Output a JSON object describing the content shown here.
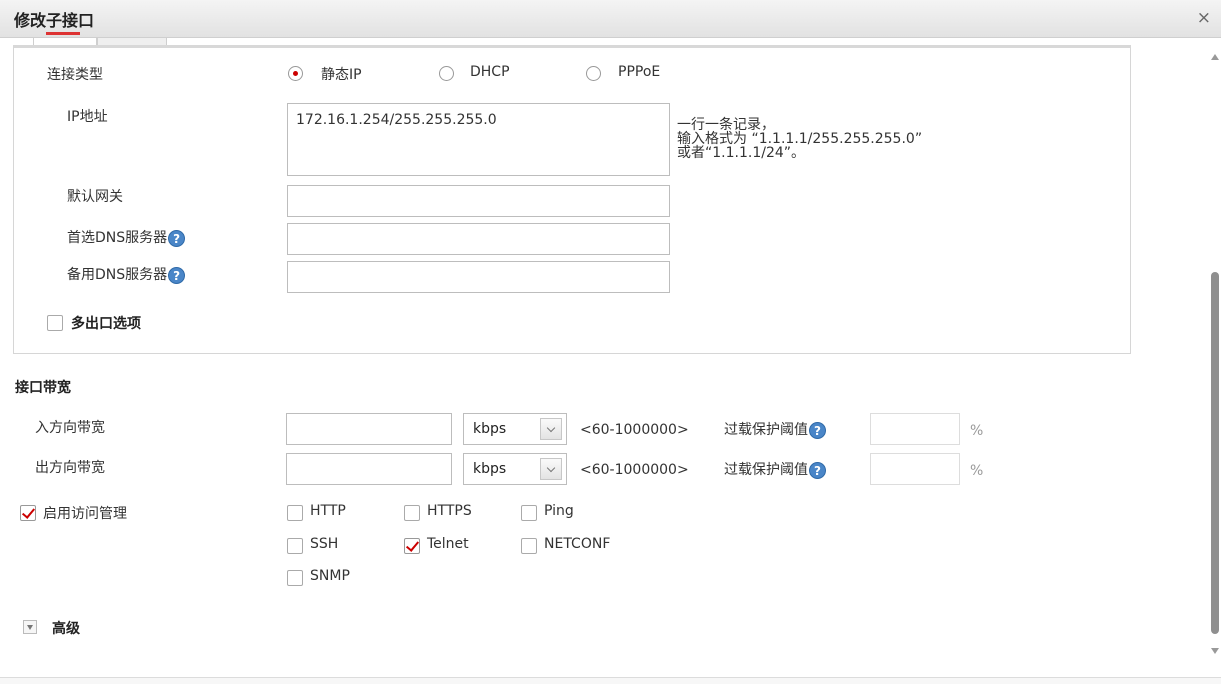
{
  "window": {
    "title": "修改子接口",
    "close_label": "×"
  },
  "connection": {
    "label": "连接类型",
    "options": [
      {
        "label": "静态IP",
        "checked": true
      },
      {
        "label": "DHCP",
        "checked": false
      },
      {
        "label": "PPPoE",
        "checked": false
      }
    ]
  },
  "ip": {
    "label": "IP地址",
    "value": "172.16.1.254/255.255.255.0",
    "hint_line1": "一行一条记录，",
    "hint_line2": "输入格式为 “1.1.1.1/255.255.255.0”",
    "hint_line3": "或者“1.1.1.1/24”。"
  },
  "gateway": {
    "label": "默认网关",
    "value": ""
  },
  "dns_primary": {
    "label": "首选DNS服务器",
    "value": ""
  },
  "dns_backup": {
    "label": "备用DNS服务器",
    "value": ""
  },
  "help_icon": "?",
  "multi_exit": {
    "label": "多出口选项",
    "checked": false
  },
  "bandwidth": {
    "section_title": "接口带宽",
    "inbound_label": "入方向带宽",
    "outbound_label": "出方向带宽",
    "unit": "kbps",
    "range": "<60-1000000>",
    "overload_label": "过载保护阈值",
    "percent": "%"
  },
  "access": {
    "label": "启用访问管理",
    "checked": true,
    "protocols": [
      {
        "label": "HTTP",
        "checked": false
      },
      {
        "label": "HTTPS",
        "checked": false
      },
      {
        "label": "Ping",
        "checked": false
      },
      {
        "label": "SSH",
        "checked": false
      },
      {
        "label": "Telnet",
        "checked": true
      },
      {
        "label": "NETCONF",
        "checked": false
      },
      {
        "label": "SNMP",
        "checked": false
      }
    ]
  },
  "advanced": {
    "label": "高级"
  },
  "colors": {
    "accent": "#cc0000",
    "help": "#4a86c8"
  }
}
